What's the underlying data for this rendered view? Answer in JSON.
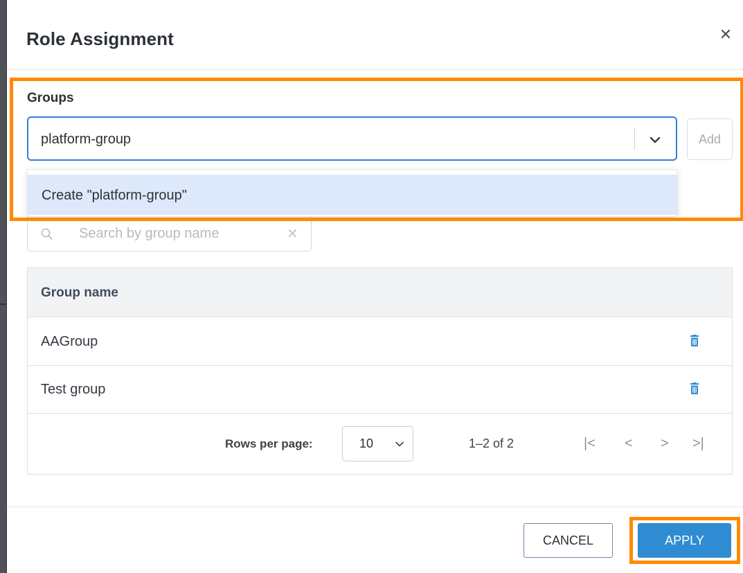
{
  "dialog": {
    "title": "Role Assignment",
    "close_icon": "close-icon"
  },
  "groups": {
    "label": "Groups",
    "select_value": "platform-group",
    "add_label": "Add",
    "dropdown_option": "Create \"platform-group\""
  },
  "search": {
    "placeholder": "Search by group name"
  },
  "table": {
    "header": "Group name",
    "rows": [
      {
        "name": "AAGroup"
      },
      {
        "name": "Test group"
      }
    ],
    "rows_per_page_label": "Rows per page:",
    "rows_per_page_value": "10",
    "range_text": "1–2 of 2",
    "pager": {
      "first": "|<",
      "prev": "<",
      "next": ">",
      "last": ">|"
    }
  },
  "actions": {
    "cancel_label": "CANCEL",
    "apply_label": "APPLY"
  },
  "colors": {
    "accent": "#2f8bd2",
    "focus_border": "#2f7fd6",
    "highlight": "#ff8a00",
    "option_hover": "#dde9fa"
  }
}
